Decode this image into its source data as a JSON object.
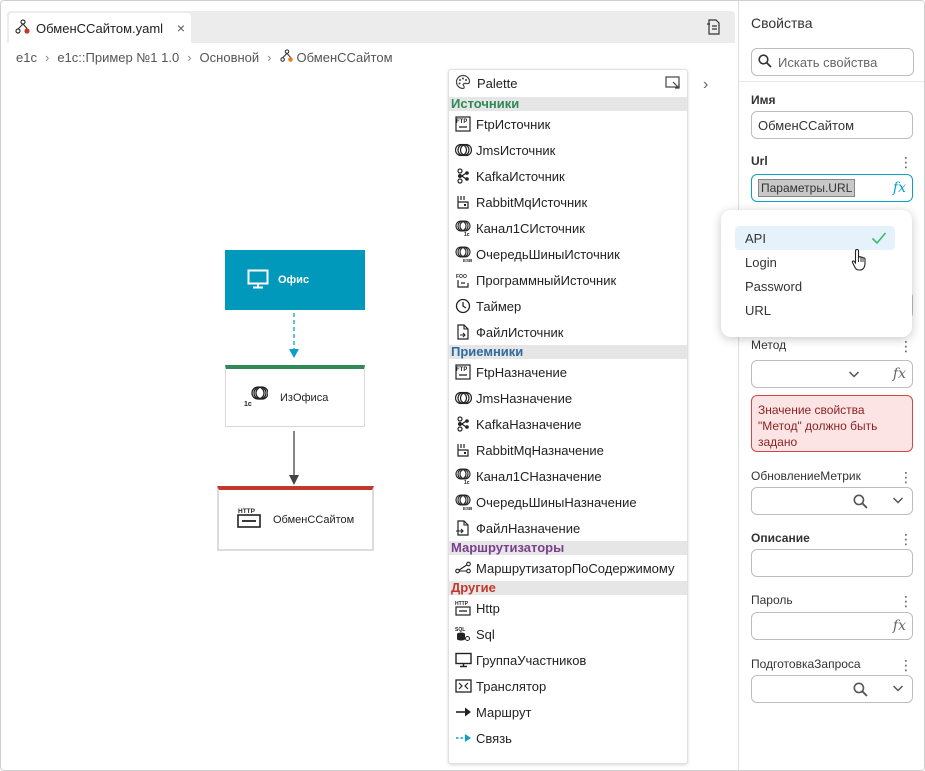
{
  "tab": {
    "label": "ОбменССайтом.yaml",
    "close": "×"
  },
  "breadcrumb": [
    "e1c",
    "e1c::Пример №1 1.0",
    "Основной",
    "ОбменССайтом"
  ],
  "canvas": {
    "nodes": [
      {
        "label": "Офис"
      },
      {
        "label": "ИзОфиса"
      },
      {
        "label": "ОбменССайтом"
      }
    ]
  },
  "palette": {
    "title": "Palette",
    "sections": [
      {
        "title": "Источники",
        "color": "#2e8b57",
        "items": [
          {
            "label": "FtpИсточник",
            "icon": "ftp-icon"
          },
          {
            "label": "JmsИсточник",
            "icon": "jms-icon"
          },
          {
            "label": "KafkaИсточник",
            "icon": "kafka-icon"
          },
          {
            "label": "RabbitMqИсточник",
            "icon": "rabbitmq-icon"
          },
          {
            "label": "Канал1СИсточник",
            "icon": "channel-1c-icon"
          },
          {
            "label": "ОчередьШиныИсточник",
            "icon": "bus-queue-icon"
          },
          {
            "label": "ПрограммныйИсточник",
            "icon": "program-source-icon"
          },
          {
            "label": "Таймер",
            "icon": "timer-icon"
          },
          {
            "label": "ФайлИсточник",
            "icon": "file-source-icon"
          }
        ]
      },
      {
        "title": "Приемники",
        "color": "#2e6b9e",
        "items": [
          {
            "label": "FtpНазначение",
            "icon": "ftp-icon"
          },
          {
            "label": "JmsНазначение",
            "icon": "jms-icon"
          },
          {
            "label": "KafkaНазначение",
            "icon": "kafka-icon"
          },
          {
            "label": "RabbitMqНазначение",
            "icon": "rabbitmq-icon"
          },
          {
            "label": "Канал1СНазначение",
            "icon": "channel-1c-icon"
          },
          {
            "label": "ОчередьШиныНазначение",
            "icon": "bus-queue-icon"
          },
          {
            "label": "ФайлНазначение",
            "icon": "file-dest-icon"
          }
        ]
      },
      {
        "title": "Маршрутизаторы",
        "color": "#7a3e8e",
        "items": [
          {
            "label": "МаршрутизаторПоСодержимому",
            "icon": "router-icon"
          }
        ]
      },
      {
        "title": "Другие",
        "color": "#c0392b",
        "items": [
          {
            "label": "Http",
            "icon": "http-icon"
          },
          {
            "label": "Sql",
            "icon": "sql-icon"
          },
          {
            "label": "ГруппаУчастников",
            "icon": "monitor-icon"
          },
          {
            "label": "Транслятор",
            "icon": "translator-icon"
          },
          {
            "label": "Маршрут",
            "icon": "route-arrow-icon"
          },
          {
            "label": "Связь",
            "icon": "link-arrow-icon"
          }
        ]
      }
    ]
  },
  "properties": {
    "title": "Свойства",
    "search_placeholder": "Искать свойства",
    "name_label": "Имя",
    "name_value": "ОбменССайтом",
    "url_label": "Url",
    "url_value": "Параметры.URL",
    "method_label": "Метод",
    "method_error": "Значение свойства \"Метод\" должно быть задано",
    "metrics_label": "ОбновлениеМетрик",
    "description_label": "Описание",
    "password_label": "Пароль",
    "request_label": "ПодготовкаЗапроса",
    "fx": "fx"
  },
  "dropdown": {
    "options": [
      "API",
      "Login",
      "Password",
      "URL"
    ],
    "selected": "API"
  },
  "colors": {
    "accent": "#0aa1c8",
    "office_node": "#0099bb",
    "error_bg": "#fde4e4",
    "error_border": "#d04848"
  }
}
